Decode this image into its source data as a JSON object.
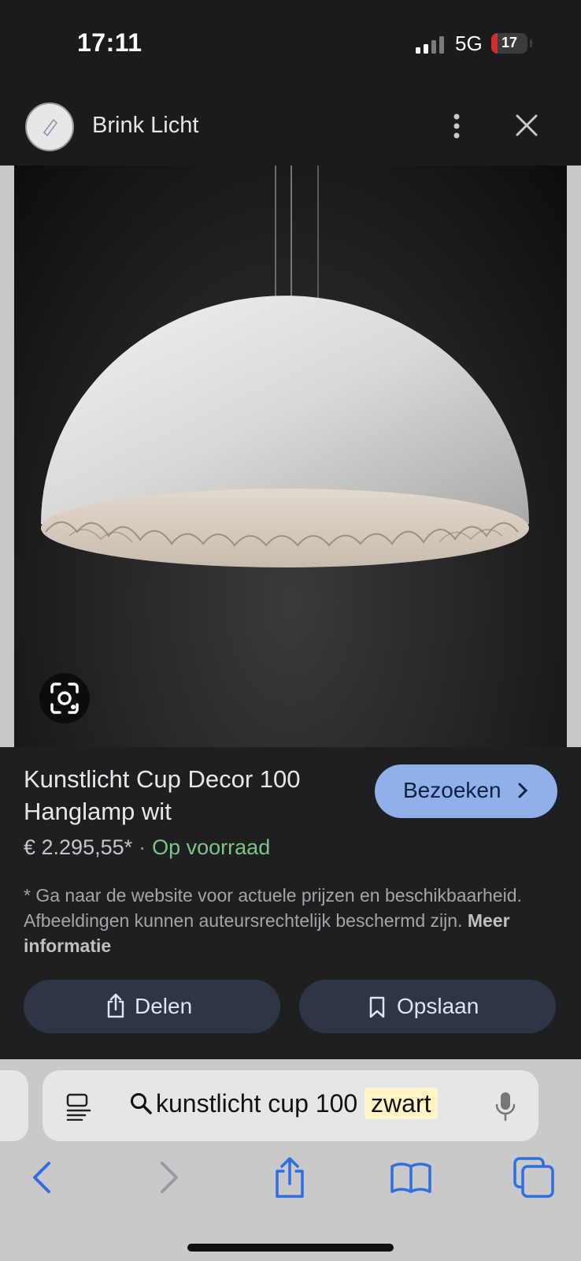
{
  "status": {
    "time": "17:11",
    "network": "5G",
    "battery": "17",
    "battery_level": 0.17
  },
  "header": {
    "site_name": "Brink Licht",
    "avatar_icon": "site-favicon-icon",
    "more_icon": "more-vertical-icon",
    "close_icon": "close-icon"
  },
  "product": {
    "title": "Kunstlicht Cup Decor 100 Hanglamp wit",
    "visit_label": "Bezoeken",
    "price": "€ 2.295,55*",
    "separator": "·",
    "stock": "Op voorraad",
    "disclaimer": "* Ga naar de website voor actuele prijzen en beschikbaarheid. Afbeeldingen kunnen auteursrechtelijk beschermd zijn.",
    "more_info": "Meer informatie",
    "share_label": "Delen",
    "save_label": "Opslaan"
  },
  "search": {
    "query_main": "kunstlicht cup 100",
    "query_highlight": "zwart"
  },
  "colors": {
    "visit_button": "#8fb0e8",
    "stock_green": "#7ec388",
    "action_button": "#2d3546",
    "toolbar_blue": "#2f6fe0",
    "highlight": "#fff5c6"
  }
}
